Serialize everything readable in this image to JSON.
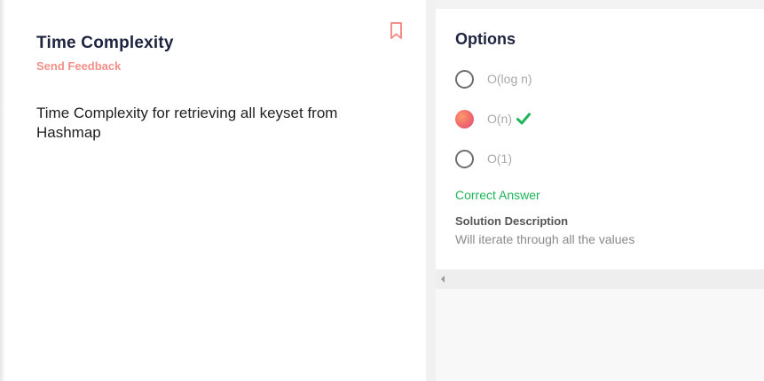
{
  "question": {
    "title": "Time Complexity",
    "feedback_label": "Send Feedback",
    "text": "Time Complexity for retrieving all keyset from Hashmap",
    "bookmark_icon": "bookmark-icon"
  },
  "options_panel": {
    "title": "Options",
    "options": [
      {
        "label": "O(log n)",
        "selected": false,
        "correct": false
      },
      {
        "label": "O(n)",
        "selected": true,
        "correct": true
      },
      {
        "label": "O(1)",
        "selected": false,
        "correct": false
      }
    ],
    "correct_answer_label": "Correct Answer",
    "solution_heading": "Solution Description",
    "solution_text": "Will iterate through all the values"
  },
  "colors": {
    "title": "#1e2440",
    "feedback": "#f3908b",
    "correct": "#1fb35a",
    "bookmark": "#f3908b"
  }
}
